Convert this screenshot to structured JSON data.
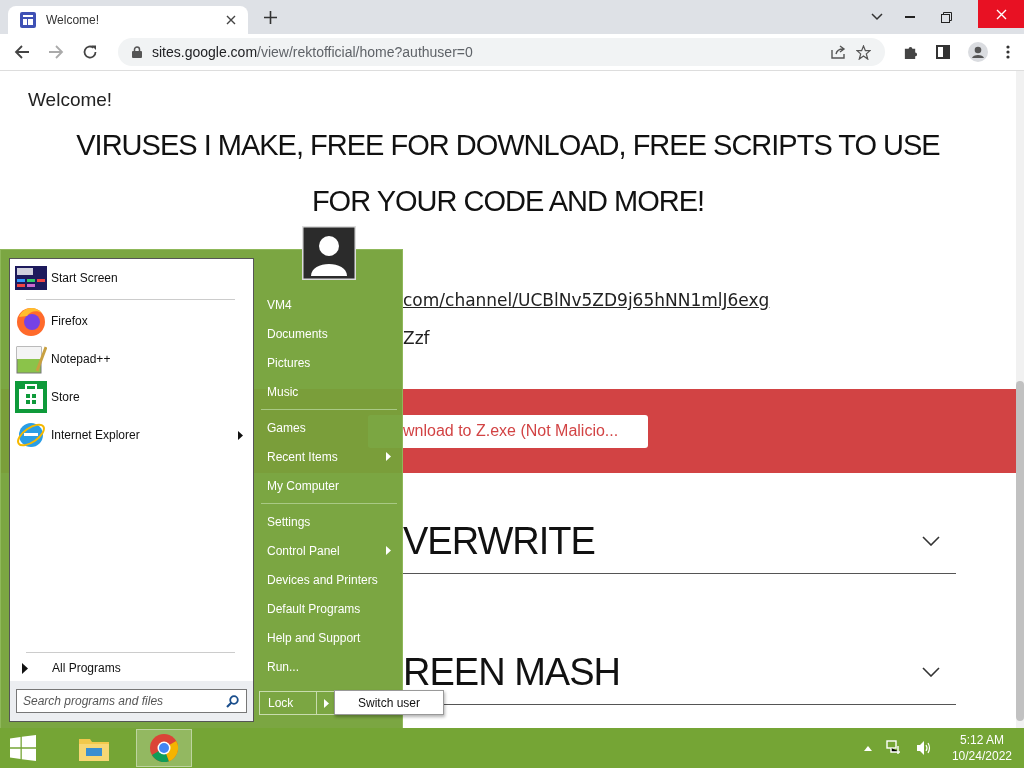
{
  "browser": {
    "tab": {
      "title": "Welcome!",
      "selected": true
    },
    "address_host": "sites.google.com",
    "address_path": "/view/rektofficial/home?authuser=0"
  },
  "page": {
    "site_title": "Welcome!",
    "heading_lines": [
      "VIRUSES I MAKE, FREE FOR DOWNLOAD, FREE SCRIPTS TO USE",
      "FOR YOUR CODE AND MORE!"
    ],
    "link": "com/channel/UCBlNv5ZD9j65hNN1mlJ6exg",
    "text": "Zzf",
    "banner_button": "wnload to Z.exe (Not Malicio...",
    "sections": [
      {
        "title": "VERWRITE",
        "expanded": false
      },
      {
        "title": "REEN MASH",
        "expanded": false
      }
    ]
  },
  "start_menu": {
    "pinned": [
      {
        "label": "Start Screen",
        "kind": "tiles",
        "submenu": false
      },
      {
        "label": "Firefox",
        "kind": "fox",
        "submenu": false
      },
      {
        "label": "Notepad++",
        "kind": "notepad",
        "submenu": false
      },
      {
        "label": "Store",
        "kind": "store",
        "submenu": false
      },
      {
        "label": "Internet Explorer",
        "kind": "ie",
        "submenu": true
      }
    ],
    "all_programs": "All Programs",
    "search": {
      "placeholder": "Search programs and files"
    },
    "places": [
      {
        "label": "VM4",
        "separator_before": false,
        "submenu": false
      },
      {
        "label": "Documents",
        "separator_before": false,
        "submenu": false
      },
      {
        "label": "Pictures",
        "separator_before": false,
        "submenu": false
      },
      {
        "label": "Music",
        "separator_before": false,
        "submenu": false
      },
      {
        "label": "Games",
        "separator_before": true,
        "submenu": false
      },
      {
        "label": "Recent Items",
        "separator_before": false,
        "submenu": true
      },
      {
        "label": "My Computer",
        "separator_before": false,
        "submenu": false
      },
      {
        "label": "Settings",
        "separator_before": true,
        "submenu": false
      },
      {
        "label": "Control Panel",
        "separator_before": false,
        "submenu": true
      },
      {
        "label": "Devices and Printers",
        "separator_before": false,
        "submenu": false
      },
      {
        "label": "Default Programs",
        "separator_before": false,
        "submenu": false
      },
      {
        "label": "Help and Support",
        "separator_before": false,
        "submenu": false
      },
      {
        "label": "Run...",
        "separator_before": false,
        "submenu": false
      }
    ],
    "lock": "Lock",
    "flyout": "Switch user"
  },
  "taskbar": {
    "apps": [
      {
        "kind": "explorer",
        "active": false
      },
      {
        "kind": "chrome",
        "active": true
      }
    ],
    "time": "5:12 AM",
    "date": "10/24/2022"
  }
}
